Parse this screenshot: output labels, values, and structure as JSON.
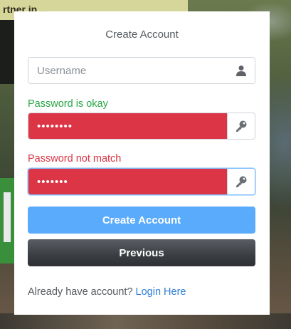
{
  "background": {
    "sign_text": "rtner in ..."
  },
  "form": {
    "title": "Create Account",
    "username": {
      "placeholder": "Username",
      "value": "",
      "icon": "user-icon"
    },
    "password": {
      "status": "Password is okay",
      "value": "••••••••",
      "icon": "key-icon"
    },
    "confirm_password": {
      "status": "Password not match",
      "value": "•••••••",
      "icon": "key-icon"
    },
    "create_button": "Create Account",
    "previous_button": "Previous",
    "footer_text": "Already have account?",
    "login_link": "Login Here"
  },
  "colors": {
    "success": "#28a745",
    "danger": "#dc3545",
    "primary": "#5aabfb",
    "dark": "#3a3d42",
    "link": "#2e7dd7"
  }
}
